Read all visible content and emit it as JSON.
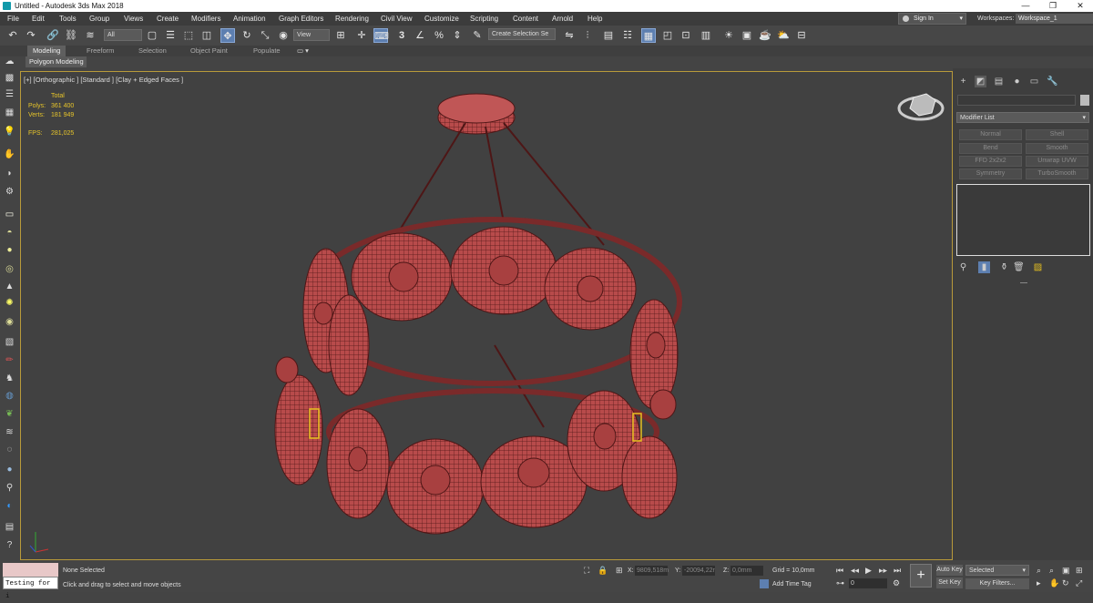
{
  "window": {
    "title": "Untitled - Autodesk 3ds Max 2018",
    "min": "—",
    "max": "❐",
    "close": "✕"
  },
  "menu": [
    "File",
    "Edit",
    "Tools",
    "Group",
    "Views",
    "Create",
    "Modifiers",
    "Animation",
    "Graph Editors",
    "Rendering",
    "Civil View",
    "Customize",
    "Scripting",
    "Content",
    "Arnold",
    "Help"
  ],
  "account": {
    "signin": "Sign In",
    "workspaces_label": "Workspaces:",
    "workspace": "Workspace_1"
  },
  "toolbar": {
    "filter": "All",
    "refcoord": "View",
    "selection_set": "Create Selection Se",
    "snap_number": "3"
  },
  "ribbon": {
    "tabs": [
      "Modeling",
      "Freeform",
      "Selection",
      "Object Paint",
      "Populate"
    ],
    "active_tab": "Modeling",
    "panel": "Polygon Modeling"
  },
  "viewport": {
    "label": "[+] [Orthographic ] [Standard ] [Clay + Edged Faces ]",
    "stats": {
      "total_label": "Total",
      "polys_label": "Polys:",
      "polys": "361 400",
      "verts_label": "Verts:",
      "verts": "181 949",
      "fps_label": "FPS:",
      "fps": "281,025"
    },
    "active_border": "#b89a3a",
    "model_color": "#b84b4b"
  },
  "command_panel": {
    "modifier_list": "Modifier List",
    "modifiers": [
      "Normal",
      "Shell",
      "Bend",
      "Smooth",
      "FFD 2x2x2",
      "Unwrap UVW",
      "Symmetry",
      "TurboSmooth"
    ]
  },
  "status": {
    "maxscript": "Testing for i",
    "selection": "None Selected",
    "prompt": "Click and drag to select and move objects",
    "x_label": "X:",
    "x": "9809,518m",
    "y_label": "Y:",
    "y": "-20094,22r",
    "z_label": "Z:",
    "z": "0,0mm",
    "grid": "Grid = 10,0mm",
    "add_time_tag": "Add Time Tag",
    "frame": "0",
    "auto_key": "Auto Key",
    "set_key": "Set Key",
    "key_mode": "Selected",
    "key_filters": "Key Filters..."
  },
  "icons": [
    "undo-icon",
    "redo-icon",
    "link-icon",
    "unlink-icon",
    "bind-space-warp-icon",
    "select-icon",
    "select-by-name-icon",
    "rect-region-icon",
    "window-crossing-icon",
    "move-icon",
    "rotate-icon",
    "scale-icon",
    "pivot-icon",
    "snap-icon",
    "angle-snap-icon",
    "percent-snap-icon",
    "spinner-snap-icon",
    "mirror-icon",
    "align-icon",
    "layer-icon",
    "ribbon-toggle-icon",
    "curve-editor-icon",
    "schematic-icon",
    "material-editor-icon",
    "render-setup-icon",
    "render-frame-icon",
    "render-icon",
    "viewcube-icon"
  ]
}
